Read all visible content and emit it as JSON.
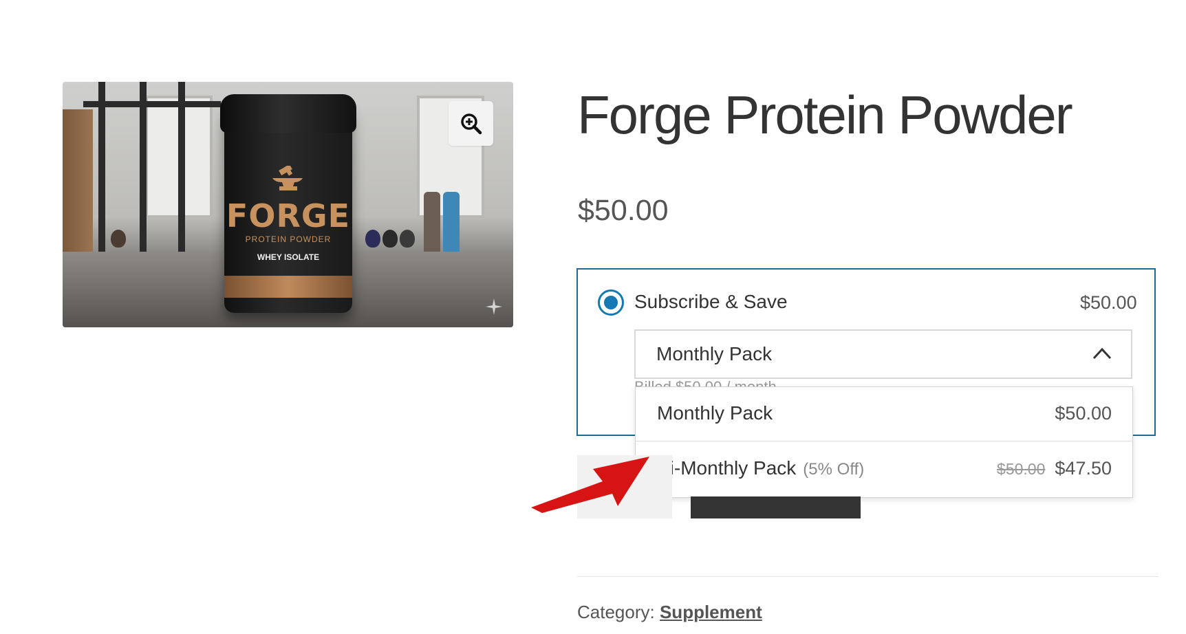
{
  "product": {
    "title": "Forge Protein Powder",
    "price": "$50.00",
    "image": {
      "brand": "FORGE",
      "subtitle": "PROTEIN POWDER",
      "type": "WHEY ISOLATE"
    }
  },
  "subscription": {
    "option_label": "Subscribe & Save",
    "option_price": "$50.00",
    "selected": true,
    "select": {
      "value": "Monthly Pack",
      "billed_note": "Billed $50.00 / month"
    },
    "dropdown": [
      {
        "label": "Monthly Pack",
        "badge": "",
        "old_price": "",
        "price": "$50.00"
      },
      {
        "label": "Bi-Monthly Pack",
        "badge": "(5% Off)",
        "old_price": "$50.00",
        "price": "$47.50"
      }
    ]
  },
  "meta": {
    "category_label": "Category:",
    "category_value": "Supplement"
  },
  "colors": {
    "accent": "#1479b2",
    "box_border": "#1d6b92",
    "annotation_arrow": "#d61414"
  },
  "icons": [
    "zoom-in-icon",
    "chevron-up-icon",
    "sparkle-icon"
  ]
}
